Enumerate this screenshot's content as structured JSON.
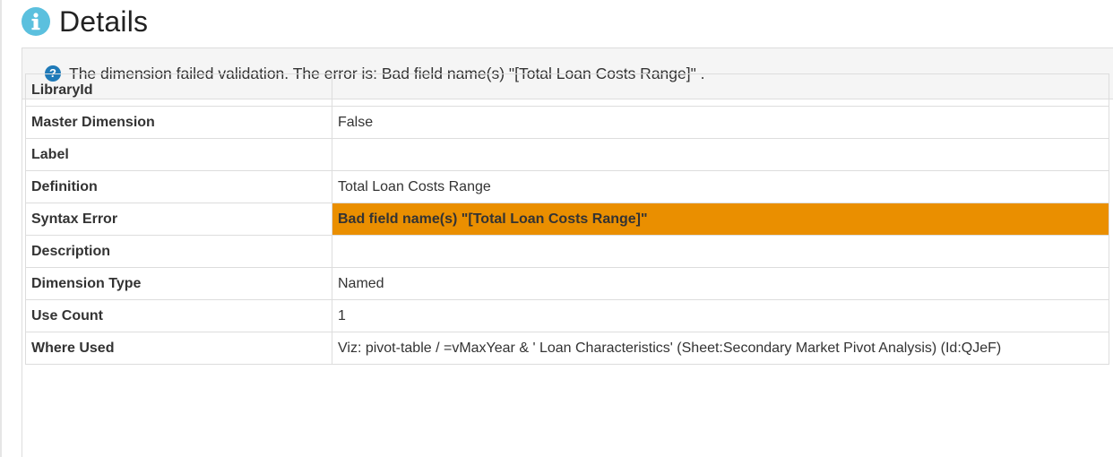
{
  "header": {
    "icon": "info-icon",
    "title": "Details"
  },
  "alert": {
    "icon": "question-circle-icon",
    "message": "The dimension failed validation. The error is: Bad field name(s) \"[Total Loan Costs Range]\" ."
  },
  "colors": {
    "info": "#5bc0de",
    "help": "#1f7ab8",
    "error_highlight": "#ea8f00"
  },
  "details": [
    {
      "key": "LibraryId",
      "value": ""
    },
    {
      "key": "Master Dimension",
      "value": "False"
    },
    {
      "key": "Label",
      "value": ""
    },
    {
      "key": "Definition",
      "value": "Total Loan Costs Range"
    },
    {
      "key": "Syntax Error",
      "value": "Bad field name(s) \"[Total Loan Costs Range]\""
    },
    {
      "key": "Description",
      "value": ""
    },
    {
      "key": "Dimension Type",
      "value": "Named"
    },
    {
      "key": "Use Count",
      "value": "1"
    },
    {
      "key": "Where Used",
      "value": "Viz: pivot-table / =vMaxYear & ' Loan Characteristics' (Sheet:Secondary Market Pivot Analysis) (Id:QJeF)"
    }
  ]
}
